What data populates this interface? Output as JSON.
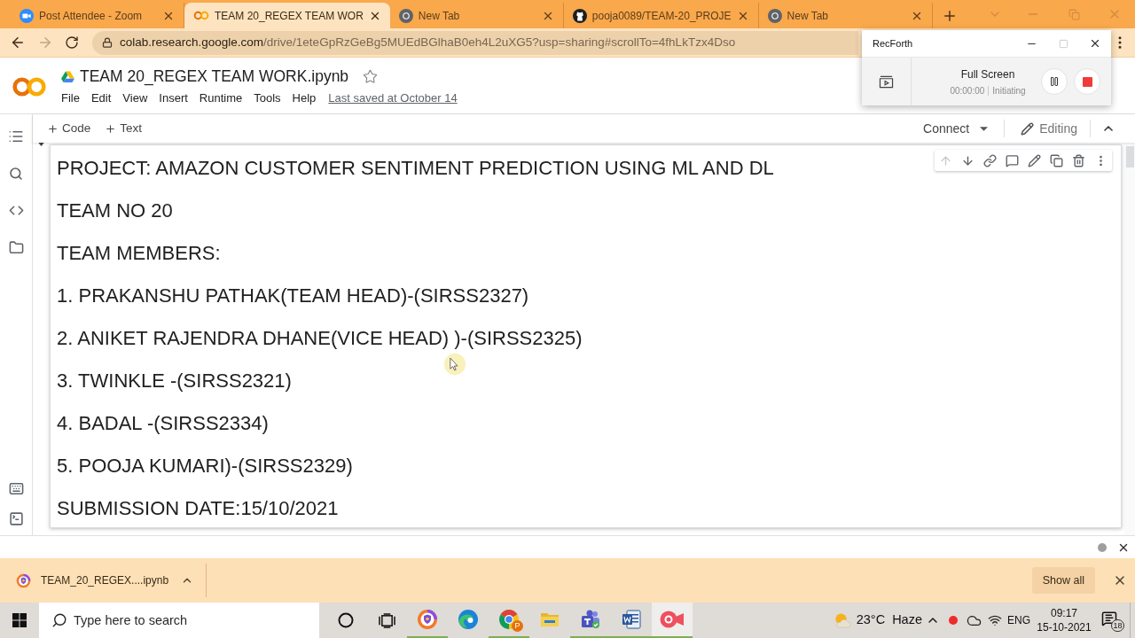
{
  "browser": {
    "tabs": [
      {
        "kind": "zoom",
        "title": "Post Attendee - Zoom",
        "selected": false
      },
      {
        "kind": "colab",
        "title": "TEAM 20_REGEX TEAM WOR",
        "selected": true
      },
      {
        "kind": "chrome",
        "title": "New Tab",
        "selected": false
      },
      {
        "kind": "github",
        "title": "pooja0089/TEAM-20_PROJE",
        "selected": false
      },
      {
        "kind": "chrome",
        "title": "New Tab",
        "selected": false
      }
    ],
    "forward_disabled": true,
    "address": {
      "host": "colab.research.google.com",
      "path": "/drive/1eteGpRzGeBg5MUEdBGlhaB0eh4L2uXG5?usp=sharing#scrollTo=4fhLkTzx4Dso"
    }
  },
  "recorder": {
    "title": "RecForth",
    "mode": "Full Screen",
    "timer": "00:00:00",
    "status": "Initiating"
  },
  "notebook": {
    "title": "TEAM 20_REGEX TEAM WORK.ipynb",
    "menu": [
      "File",
      "Edit",
      "View",
      "Insert",
      "Runtime",
      "Tools",
      "Help"
    ],
    "last_saved": "Last saved at October 14",
    "add_buttons": [
      "Code",
      "Text"
    ],
    "runtime": "Connect",
    "mode": "Editing",
    "cell": {
      "actions": [
        {
          "kind": "move-up",
          "disabled": true
        },
        {
          "kind": "move-down",
          "disabled": false
        },
        {
          "kind": "link",
          "disabled": false
        },
        {
          "kind": "comment",
          "disabled": false
        },
        {
          "kind": "edit",
          "disabled": false
        },
        {
          "kind": "mirror",
          "disabled": false
        },
        {
          "kind": "delete",
          "disabled": false
        },
        {
          "kind": "more",
          "disabled": false
        }
      ],
      "lines": [
        "PROJECT: AMAZON CUSTOMER SENTIMENT PREDICTION USING ML AND DL",
        "TEAM NO 20",
        "TEAM MEMBERS:",
        "1. PRAKANSHU PATHAK(TEAM HEAD)-(SIRSS2327)",
        "2. ANIKET RAJENDRA DHANE(VICE HEAD) )-(SIRSS2325)",
        "3. TWINKLE -(SIRSS2321)",
        "4. BADAL -(SIRSS2334)",
        "5. POOJA KUMARI)-(SIRSS2329)",
        "SUBMISSION DATE:15/10/2021"
      ]
    }
  },
  "downloads": {
    "items": [
      {
        "name": "TEAM_20_REGEX....ipynb"
      }
    ],
    "show_all": "Show all"
  },
  "taskbar": {
    "search_placeholder": "Type here to search",
    "apps": [
      {
        "kind": "shield-browser",
        "running": true,
        "selected": false
      },
      {
        "kind": "edge",
        "running": false,
        "selected": false
      },
      {
        "kind": "chrome",
        "running": true,
        "selected": false,
        "badge": "P"
      },
      {
        "kind": "explorer",
        "running": false,
        "selected": false
      },
      {
        "kind": "teams",
        "running": true,
        "selected": false
      },
      {
        "kind": "word",
        "running": true,
        "selected": false
      },
      {
        "kind": "recorder",
        "running": true,
        "selected": true
      }
    ],
    "weather": {
      "temperature": "23°C",
      "condition": "Haze"
    },
    "language": "ENG",
    "time": "09:17",
    "date": "15-10-2021",
    "notification_count": "18"
  }
}
